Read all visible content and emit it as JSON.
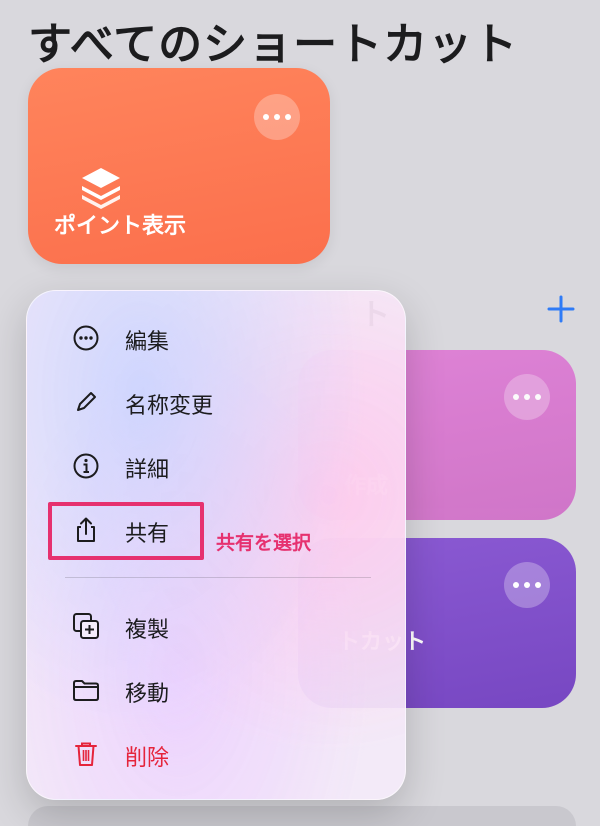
{
  "page": {
    "title": "すべてのショートカット"
  },
  "cards": {
    "main": {
      "title": "ポイント表示",
      "icon": "layers-stack-icon"
    },
    "pink": {
      "title_partial": "作成"
    },
    "purple": {
      "title_partial": "トカット"
    }
  },
  "section": {
    "title_partial": "ト"
  },
  "menu": {
    "items": [
      {
        "label": "編集",
        "icon": "ellipsis-circle-icon"
      },
      {
        "label": "名称変更",
        "icon": "pencil-icon"
      },
      {
        "label": "詳細",
        "icon": "info-circle-icon"
      },
      {
        "label": "共有",
        "icon": "share-icon"
      },
      {
        "label": "複製",
        "icon": "duplicate-icon"
      },
      {
        "label": "移動",
        "icon": "folder-icon"
      },
      {
        "label": "削除",
        "icon": "trash-icon"
      }
    ]
  },
  "annotation": {
    "text": "共有を選択",
    "color": "#e6316f"
  },
  "colors": {
    "main_card": "#fb6f4c",
    "pink_card": "#d874cf",
    "purple_card": "#7c4cc7",
    "accent_blue": "#2f7bf6",
    "danger_red": "#e5243b"
  }
}
